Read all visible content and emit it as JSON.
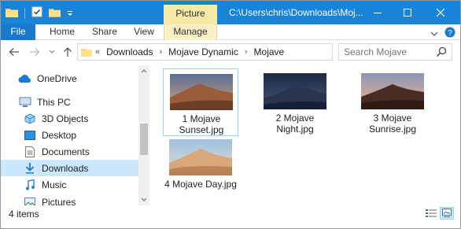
{
  "title_bar": {
    "contextual_tab_group": "Picture Tools",
    "path_title": "C:\\Users\\chris\\Downloads\\Moj..."
  },
  "ribbon": {
    "tabs": [
      {
        "label": "File",
        "active": true
      },
      {
        "label": "Home"
      },
      {
        "label": "Share"
      },
      {
        "label": "View"
      },
      {
        "label": "Manage"
      }
    ]
  },
  "address_bar": {
    "overflow_marker": "«",
    "crumbs": [
      "Downloads",
      "Mojave Dynamic",
      "Mojave"
    ]
  },
  "search": {
    "placeholder": "Search Mojave"
  },
  "nav_pane": {
    "items": [
      {
        "label": "OneDrive",
        "icon": "cloud-icon"
      },
      {
        "label": "This PC",
        "icon": "computer-icon"
      },
      {
        "label": "3D Objects",
        "icon": "cube-icon"
      },
      {
        "label": "Desktop",
        "icon": "desktop-icon"
      },
      {
        "label": "Documents",
        "icon": "document-icon"
      },
      {
        "label": "Downloads",
        "icon": "download-icon",
        "selected": true
      },
      {
        "label": "Music",
        "icon": "music-icon"
      },
      {
        "label": "Pictures",
        "icon": "pictures-icon"
      }
    ]
  },
  "files": [
    {
      "name": "1 Mojave Sunset.jpg",
      "thumb_style": "sunset",
      "selected": true
    },
    {
      "name": "2 Mojave Night.jpg",
      "thumb_style": "night"
    },
    {
      "name": "3 Mojave Sunrise.jpg",
      "thumb_style": "sunrise"
    },
    {
      "name": "4 Mojave Day.jpg",
      "thumb_style": "day"
    }
  ],
  "status": {
    "item_count": "4 items"
  },
  "colors": {
    "titlebar": "#1883d7",
    "file_tab": "#1979ca",
    "contextual": "#f8eaa6",
    "selection": "#cce8ff"
  }
}
